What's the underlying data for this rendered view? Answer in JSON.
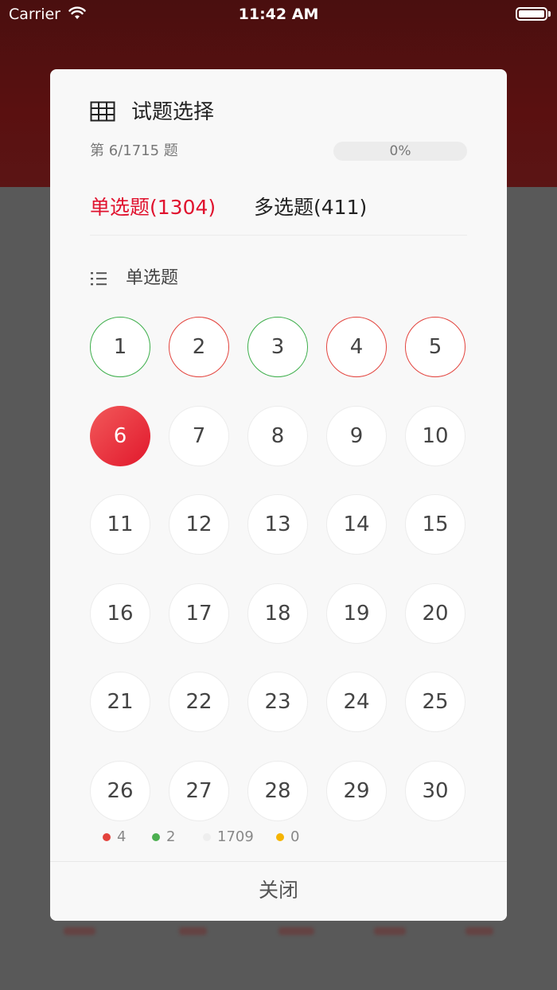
{
  "status_bar": {
    "carrier": "Carrier",
    "time": "11:42 AM"
  },
  "dialog": {
    "title": "试题选择",
    "progress_text": "第 6/1715 题",
    "progress_percent_label": "0%",
    "progress_value": 0,
    "tabs": [
      {
        "label": "单选题(1304)",
        "active": true
      },
      {
        "label": "多选题(411)",
        "active": false
      }
    ],
    "section_title": "单选题",
    "questions": [
      {
        "n": "1",
        "state": "correct"
      },
      {
        "n": "2",
        "state": "wrong"
      },
      {
        "n": "3",
        "state": "correct"
      },
      {
        "n": "4",
        "state": "wrong"
      },
      {
        "n": "5",
        "state": "wrong"
      },
      {
        "n": "6",
        "state": "current"
      },
      {
        "n": "7",
        "state": "unanswered"
      },
      {
        "n": "8",
        "state": "unanswered"
      },
      {
        "n": "9",
        "state": "unanswered"
      },
      {
        "n": "10",
        "state": "unanswered"
      },
      {
        "n": "11",
        "state": "unanswered"
      },
      {
        "n": "12",
        "state": "unanswered"
      },
      {
        "n": "13",
        "state": "unanswered"
      },
      {
        "n": "14",
        "state": "unanswered"
      },
      {
        "n": "15",
        "state": "unanswered"
      },
      {
        "n": "16",
        "state": "unanswered"
      },
      {
        "n": "17",
        "state": "unanswered"
      },
      {
        "n": "18",
        "state": "unanswered"
      },
      {
        "n": "19",
        "state": "unanswered"
      },
      {
        "n": "20",
        "state": "unanswered"
      },
      {
        "n": "21",
        "state": "unanswered"
      },
      {
        "n": "22",
        "state": "unanswered"
      },
      {
        "n": "23",
        "state": "unanswered"
      },
      {
        "n": "24",
        "state": "unanswered"
      },
      {
        "n": "25",
        "state": "unanswered"
      },
      {
        "n": "26",
        "state": "unanswered"
      },
      {
        "n": "27",
        "state": "unanswered"
      },
      {
        "n": "28",
        "state": "unanswered"
      },
      {
        "n": "29",
        "state": "unanswered"
      },
      {
        "n": "30",
        "state": "unanswered"
      }
    ],
    "legend": [
      {
        "value": "4",
        "color": "#e3433d"
      },
      {
        "value": "2",
        "color": "#4caf50"
      },
      {
        "value": "1709",
        "color": "#eeeeee"
      },
      {
        "value": "0",
        "color": "#f5b400"
      }
    ],
    "close_label": "关闭"
  },
  "colors": {
    "accent": "#e0122e",
    "correct": "#3cae4a",
    "wrong": "#e3433d"
  }
}
